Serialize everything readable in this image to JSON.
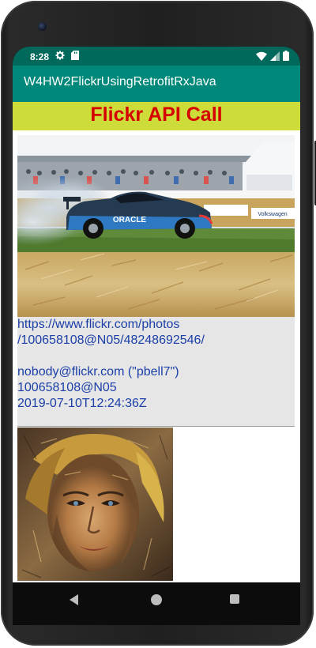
{
  "status_bar": {
    "time": "8:28",
    "left_icons": [
      "gear-icon",
      "sd-card-icon"
    ],
    "right_icons": [
      "wifi-icon",
      "signal-icon",
      "battery-icon"
    ]
  },
  "app_bar": {
    "title": "W4HW2FlickrUsingRetrofitRxJava"
  },
  "banner": {
    "text": "Flickr API Call"
  },
  "items": [
    {
      "link_line1": "https://www.flickr.com/photos",
      "link_line2": "/100658108@N05/48248692546/",
      "author": "nobody@flickr.com (\"pbell7\")",
      "author_id": "100658108@N05",
      "published": "2019-07-10T12:24:36Z"
    }
  ],
  "photo_1": {
    "car_sign": "ORACLE",
    "banner_sign": "Volkswagen"
  },
  "nav_bar": {
    "buttons": [
      "back-icon",
      "home-icon",
      "recents-icon"
    ]
  },
  "colors": {
    "status_bar": "#00695c",
    "app_bar": "#00897b",
    "banner_bg": "#cddc39",
    "banner_text": "#d50000",
    "link_text": "#1a3fa8"
  }
}
